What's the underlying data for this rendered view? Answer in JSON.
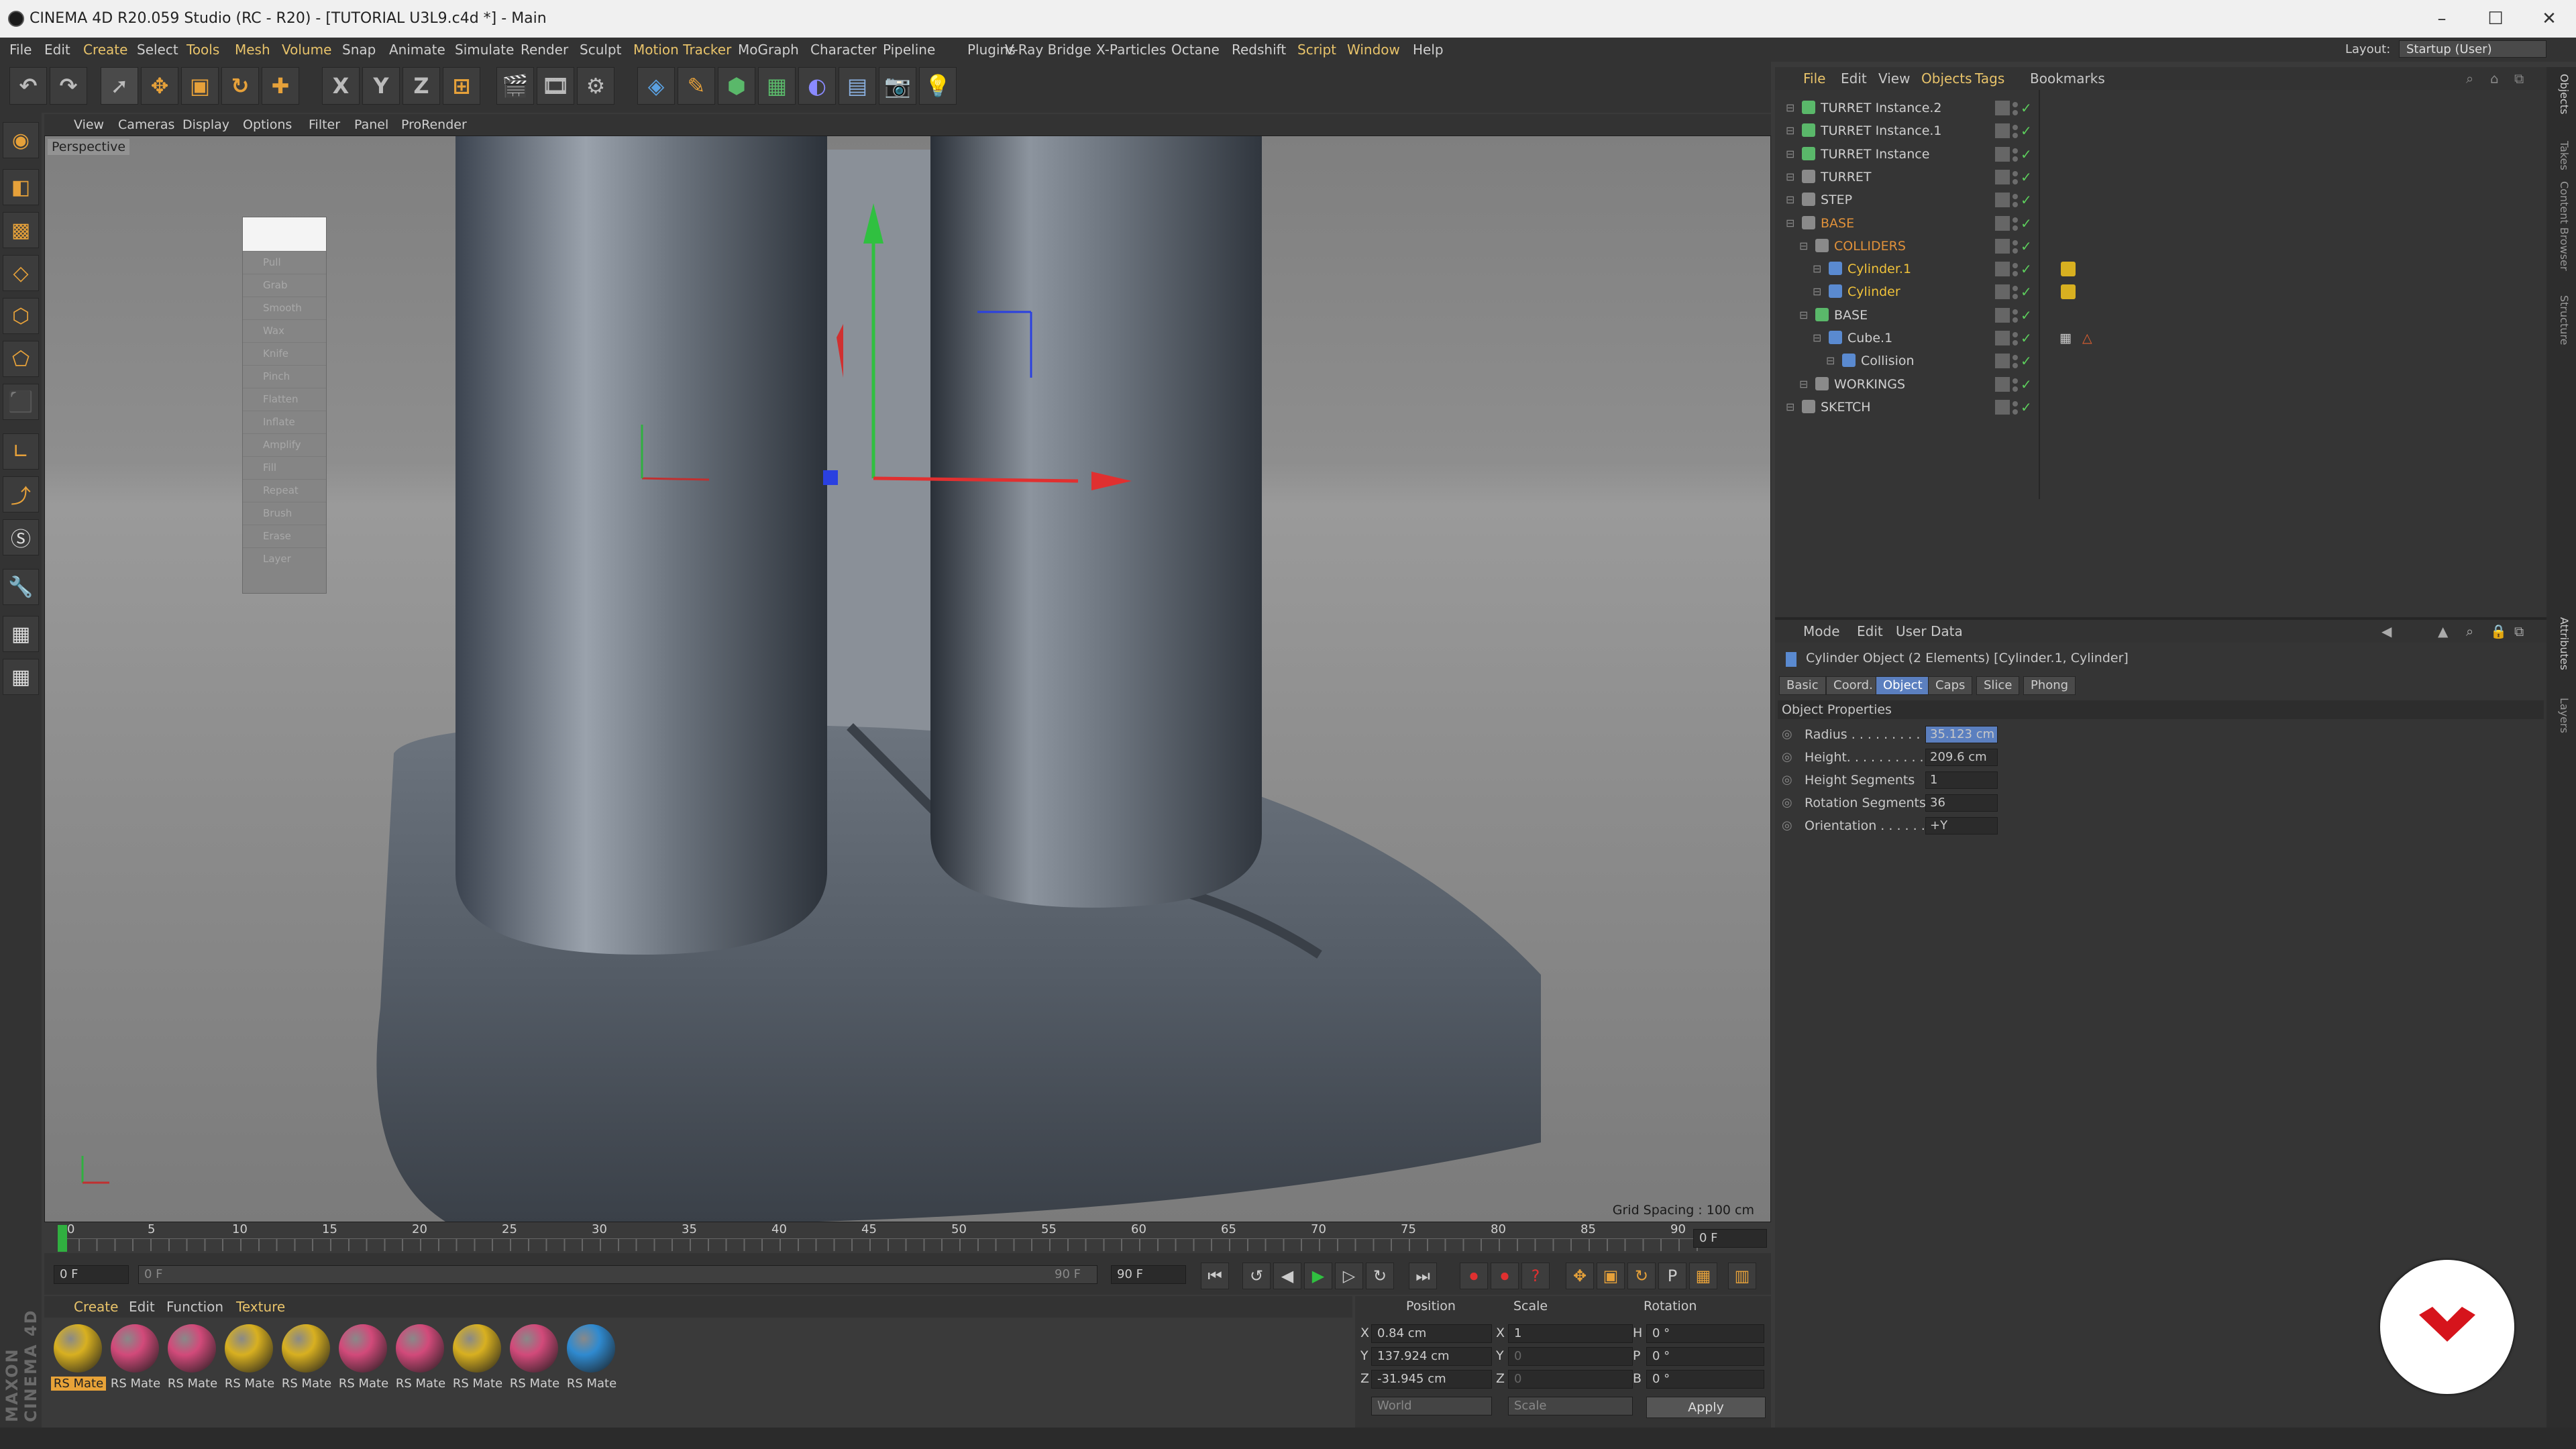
{
  "window": {
    "title": "CINEMA 4D R20.059 Studio (RC - R20) - [TUTORIAL U3L9.c4d *] - Main",
    "controls": [
      "–",
      "☐",
      "✕"
    ]
  },
  "menu": [
    "File",
    "Edit",
    "Create",
    "Select",
    "Tools",
    "Mesh",
    "Volume",
    "Snap",
    "Animate",
    "Simulate",
    "Render",
    "Sculpt",
    "Motion Tracker",
    "MoGraph",
    "Character",
    "Pipeline",
    "Plugins",
    "V-Ray Bridge",
    "X-Particles",
    "Octane",
    "Redshift",
    "Script",
    "Window",
    "Help"
  ],
  "layout": {
    "label": "Layout:",
    "value": "Startup (User)"
  },
  "toolbar": {
    "x": "X",
    "y": "Y",
    "z": "Z"
  },
  "viewport_menu": [
    "View",
    "Cameras",
    "Display",
    "Options",
    "Filter",
    "Panel",
    "ProRender"
  ],
  "viewport": {
    "label": "Perspective",
    "grid_spacing": "Grid Spacing : 100 cm",
    "float_panel": [
      "Pull",
      "Grab",
      "Smooth",
      "Wax",
      "Knife",
      "Pinch",
      "Flatten",
      "Inflate",
      "Amplify",
      "Fill",
      "Repeat",
      "Brush",
      "Erase",
      "Layer"
    ]
  },
  "timeline": {
    "ticks": [
      "0",
      "5",
      "10",
      "15",
      "20",
      "25",
      "30",
      "35",
      "40",
      "45",
      "50",
      "55",
      "60",
      "65",
      "70",
      "75",
      "80",
      "85",
      "90"
    ],
    "current_frame_field": "0 F",
    "start_field": "0 F",
    "range_start": "0 F",
    "range_end": "90 F",
    "end_field": "90 F"
  },
  "materials": {
    "menu": [
      "Create",
      "Edit",
      "Function",
      "Texture"
    ],
    "items": [
      {
        "label": "RS Mate",
        "color": "#d8b020",
        "selected": true
      },
      {
        "label": "RS Mate",
        "color": "#d24a7a",
        "selected": false
      },
      {
        "label": "RS Mate",
        "color": "#d24a7a",
        "selected": false
      },
      {
        "label": "RS Mate",
        "color": "#d8b020",
        "selected": false
      },
      {
        "label": "RS Mate",
        "color": "#d8b020",
        "selected": false
      },
      {
        "label": "RS Mate",
        "color": "#d24a7a",
        "selected": false
      },
      {
        "label": "RS Mate",
        "color": "#d24a7a",
        "selected": false
      },
      {
        "label": "RS Mate",
        "color": "#d8b020",
        "selected": false
      },
      {
        "label": "RS Mate",
        "color": "#d24a7a",
        "selected": false
      },
      {
        "label": "RS Mate",
        "color": "#2f8ad0",
        "selected": false
      }
    ]
  },
  "coordinates": {
    "headers": [
      "Position",
      "Scale",
      "Rotation"
    ],
    "rows": [
      {
        "axis": "X",
        "pos": "0.84 cm",
        "scale_axis": "X",
        "scale": "1",
        "rot_axis": "H",
        "rot": "0 °"
      },
      {
        "axis": "Y",
        "pos": "137.924 cm",
        "scale_axis": "Y",
        "scale": "0",
        "rot_axis": "P",
        "rot": "0 °"
      },
      {
        "axis": "Z",
        "pos": "-31.945 cm",
        "scale_axis": "Z",
        "scale": "0",
        "rot_axis": "B",
        "rot": "0 °"
      }
    ],
    "mode": "World",
    "scale_mode": "Scale",
    "apply": "Apply"
  },
  "object_manager": {
    "menu": [
      "File",
      "Edit",
      "View",
      "Objects",
      "Tags",
      "Bookmarks"
    ],
    "rows": [
      {
        "name": "TURRET Instance.2",
        "indent": 0,
        "color": "#cfcfcf",
        "icon": "#5ab86a"
      },
      {
        "name": "TURRET Instance.1",
        "indent": 0,
        "color": "#cfcfcf",
        "icon": "#5ab86a"
      },
      {
        "name": "TURRET Instance",
        "indent": 0,
        "color": "#cfcfcf",
        "icon": "#5ab86a"
      },
      {
        "name": "TURRET",
        "indent": 0,
        "color": "#cfcfcf",
        "icon": "#8a8a8a"
      },
      {
        "name": "STEP",
        "indent": 0,
        "color": "#cfcfcf",
        "icon": "#8a8a8a"
      },
      {
        "name": "BASE",
        "indent": 0,
        "color": "#e0913a",
        "icon": "#8a8a8a"
      },
      {
        "name": "COLLIDERS",
        "indent": 1,
        "color": "#e0913a",
        "icon": "#8a8a8a"
      },
      {
        "name": "Cylinder.1",
        "indent": 2,
        "color": "#f0c23a",
        "icon": "#5a8ad0"
      },
      {
        "name": "Cylinder",
        "indent": 2,
        "color": "#f0c23a",
        "icon": "#5a8ad0"
      },
      {
        "name": "BASE",
        "indent": 1,
        "color": "#cfcfcf",
        "icon": "#5ab86a"
      },
      {
        "name": "Cube.1",
        "indent": 2,
        "color": "#cfcfcf",
        "icon": "#5a8ad0"
      },
      {
        "name": "Collision",
        "indent": 3,
        "color": "#cfcfcf",
        "icon": "#5a8ad0"
      },
      {
        "name": "WORKINGS",
        "indent": 1,
        "color": "#cfcfcf",
        "icon": "#8a8a8a"
      },
      {
        "name": "SKETCH",
        "indent": 0,
        "color": "#cfcfcf",
        "icon": "#8a8a8a"
      }
    ]
  },
  "attributes": {
    "menu": [
      "Mode",
      "Edit",
      "User Data"
    ],
    "title": "Cylinder Object (2 Elements) [Cylinder.1, Cylinder]",
    "tabs": [
      "Basic",
      "Coord.",
      "Object",
      "Caps",
      "Slice",
      "Phong"
    ],
    "active_tab": "Object",
    "section": "Object Properties",
    "props": [
      {
        "label": "Radius . . . . . . . . . . .",
        "value": "35.123 cm"
      },
      {
        "label": "Height. . . . . . . . . . . .",
        "value": "209.6 cm"
      },
      {
        "label": "Height Segments",
        "value": "1"
      },
      {
        "label": "Rotation Segments",
        "value": "36"
      },
      {
        "label": "Orientation . . . . . . .",
        "value": "+Y"
      }
    ]
  },
  "right_tabs": [
    "Objects",
    "Takes",
    "Content Browser",
    "Structure",
    "Attributes",
    "Layers"
  ],
  "branding": {
    "maxon": "MAXON CINEMA 4D"
  }
}
